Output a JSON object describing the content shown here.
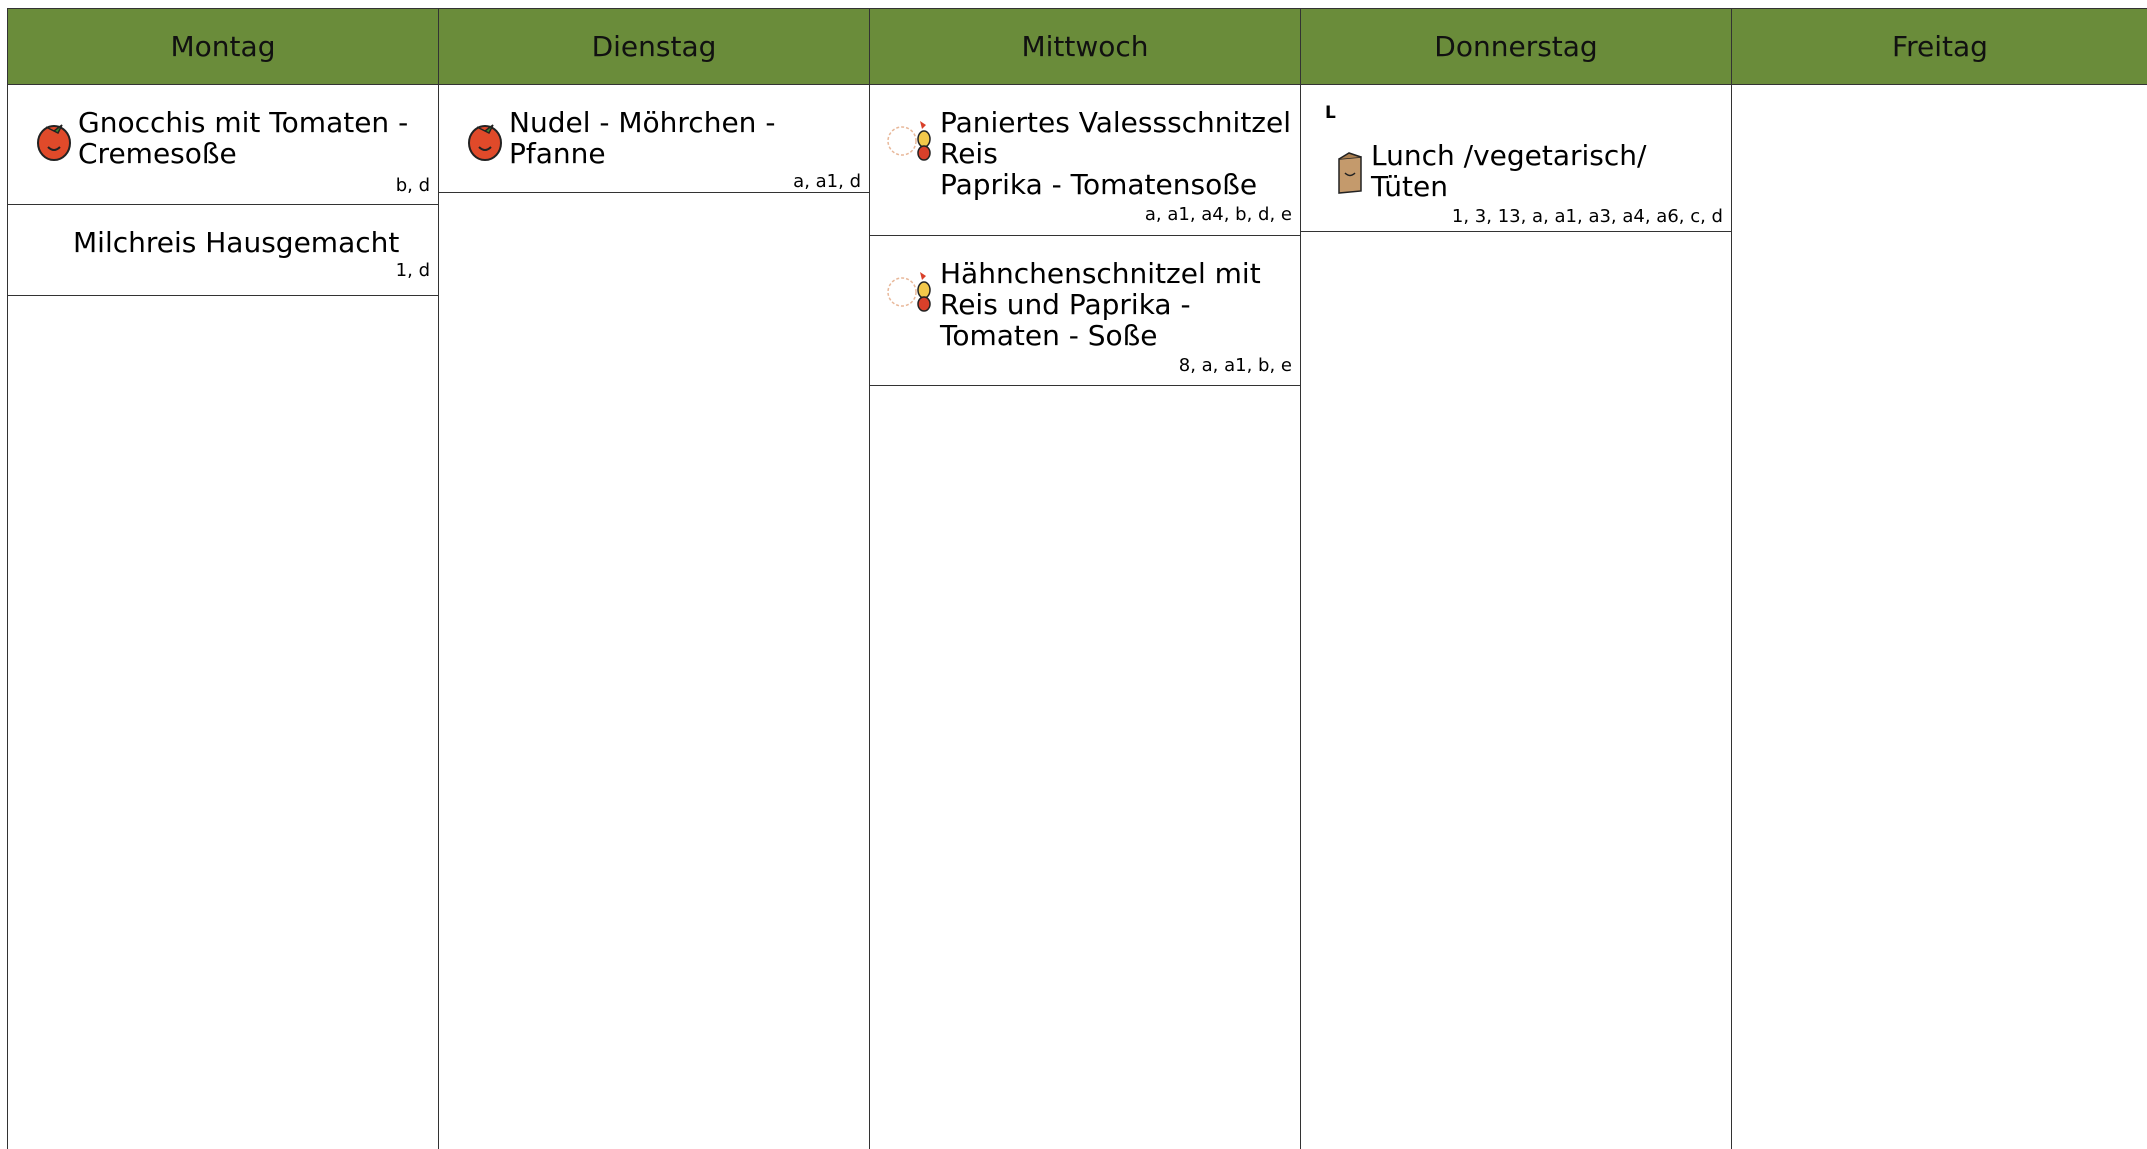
{
  "days": [
    {
      "label": "Montag",
      "meals": [
        {
          "name": "Gnocchis mit Tomaten -\nCremesoße",
          "allergens": "b, d",
          "icon": "tomato-icon"
        },
        {
          "name": "Milchreis Hausgemacht",
          "allergens": "1, d",
          "icon": ""
        }
      ]
    },
    {
      "label": "Dienstag",
      "meals": [
        {
          "name": "Nudel - Möhrchen - Pfanne",
          "allergens": "a, a1, d",
          "icon": "tomato-icon"
        }
      ]
    },
    {
      "label": "Mittwoch",
      "meals": [
        {
          "name": "Paniertes Valessschnitzel\nReis\nPaprika - Tomatensoße",
          "allergens": "a, a1, a4, b, d, e",
          "icon": "chicken-icon"
        },
        {
          "name": "Hähnchenschnitzel mit\nReis und Paprika -\nTomaten - Soße",
          "allergens": "8, a, a1, b, e",
          "icon": "chicken-icon"
        }
      ]
    },
    {
      "label": "Donnerstag",
      "meals": [
        {
          "marker": "L",
          "name": "Lunch /vegetarisch/ Tüten",
          "allergens": "1, 3, 13, a, a1, a3, a4, a6, c, d",
          "icon": "lunch-bag-icon"
        }
      ]
    },
    {
      "label": "Freitag",
      "meals": []
    }
  ],
  "colors": {
    "header": "#6a8c3a"
  }
}
